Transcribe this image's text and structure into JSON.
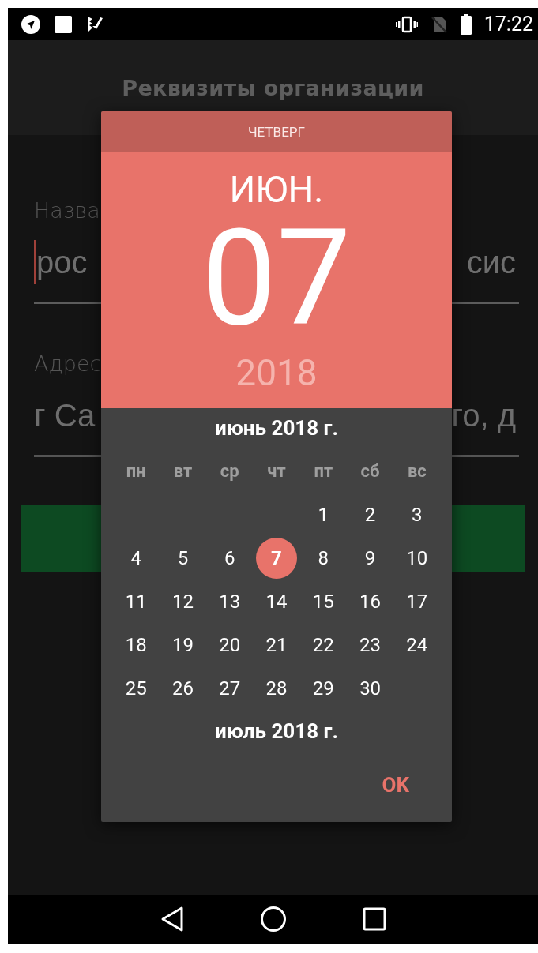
{
  "status_bar": {
    "time": "17:22"
  },
  "app_bar": {
    "title": "Реквизиты организации"
  },
  "form": {
    "fields": [
      {
        "label": "Назва",
        "value_start": "рос",
        "value_end": "сис",
        "focused": true
      },
      {
        "label": "Адрес",
        "value_start": "г Са",
        "value_end": "го, д",
        "focused": false
      }
    ]
  },
  "date_picker": {
    "weekday": "ЧЕТВЕРГ",
    "month": "ИЮН.",
    "day": "07",
    "year": "2018",
    "month_title": "июнь 2018 г.",
    "weekday_names": [
      "пн",
      "вт",
      "ср",
      "чт",
      "пт",
      "сб",
      "вс"
    ],
    "weeks": [
      {
        "kind": "leading",
        "days": [
          {
            "day": "1",
            "selected": false
          },
          {
            "day": "2",
            "selected": false
          },
          {
            "day": "3",
            "selected": false
          }
        ]
      },
      {
        "kind": "full",
        "days": [
          {
            "day": "4",
            "selected": false
          },
          {
            "day": "5",
            "selected": false
          },
          {
            "day": "6",
            "selected": false
          },
          {
            "day": "7",
            "selected": true
          },
          {
            "day": "8",
            "selected": false
          },
          {
            "day": "9",
            "selected": false
          },
          {
            "day": "10",
            "selected": false
          }
        ]
      },
      {
        "kind": "full",
        "days": [
          {
            "day": "11",
            "selected": false
          },
          {
            "day": "12",
            "selected": false
          },
          {
            "day": "13",
            "selected": false
          },
          {
            "day": "14",
            "selected": false
          },
          {
            "day": "15",
            "selected": false
          },
          {
            "day": "16",
            "selected": false
          },
          {
            "day": "17",
            "selected": false
          }
        ]
      },
      {
        "kind": "full",
        "days": [
          {
            "day": "18",
            "selected": false
          },
          {
            "day": "19",
            "selected": false
          },
          {
            "day": "20",
            "selected": false
          },
          {
            "day": "21",
            "selected": false
          },
          {
            "day": "22",
            "selected": false
          },
          {
            "day": "23",
            "selected": false
          },
          {
            "day": "24",
            "selected": false
          }
        ]
      },
      {
        "kind": "trailing",
        "days": [
          {
            "day": "25",
            "selected": false
          },
          {
            "day": "26",
            "selected": false
          },
          {
            "day": "27",
            "selected": false
          },
          {
            "day": "28",
            "selected": false
          },
          {
            "day": "29",
            "selected": false
          },
          {
            "day": "30",
            "selected": false
          }
        ]
      }
    ],
    "next_month_title": "июль 2018 г.",
    "ok_button": "OK"
  }
}
